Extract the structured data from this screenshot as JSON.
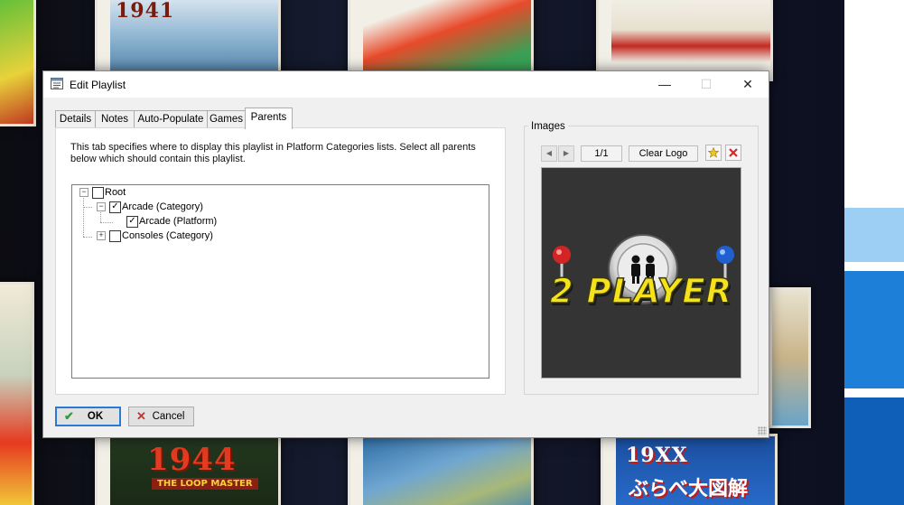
{
  "background": {
    "covers": [
      {
        "title": "1941",
        "subtitle": "",
        "japanese": ""
      },
      {
        "title": "1944",
        "subtitle": "THE LOOP MASTER",
        "japanese": ""
      },
      {
        "title": "19XX",
        "subtitle": "",
        "japanese": "ぶらべ大図解"
      }
    ]
  },
  "dialog": {
    "title": "Edit Playlist",
    "window_controls": {
      "minimize": "—",
      "maximize": "☐",
      "close": "✕"
    },
    "tabs": [
      "Details",
      "Notes",
      "Auto-Populate",
      "Games",
      "Parents"
    ],
    "active_tab": "Parents",
    "parents": {
      "description": "This tab specifies where to display this playlist in Platform Categories lists. Select all parents below which should contain this playlist.",
      "tree": [
        {
          "label": "Root",
          "checked": false,
          "expander": "−"
        },
        {
          "label": "Arcade (Category)",
          "checked": true,
          "expander": "−"
        },
        {
          "label": "Arcade (Platform)",
          "checked": true,
          "expander": ""
        },
        {
          "label": "Consoles (Category)",
          "checked": false,
          "expander": "+"
        }
      ]
    },
    "images": {
      "group_label": "Images",
      "prev_icon": "◀",
      "next_icon": "▶",
      "counter": "1/1",
      "image_type": "Clear Logo",
      "add_icon": "star-icon",
      "delete_icon": "delete-x-icon",
      "logo_text": "2 PLAYER"
    },
    "buttons": {
      "ok": "OK",
      "cancel": "Cancel"
    },
    "colors": {
      "accent": "#2a7ad5",
      "checkmark_ok": "#2e9e3a",
      "cancel_x": "#d12b2b",
      "logo_yellow": "#f5e21a"
    }
  }
}
